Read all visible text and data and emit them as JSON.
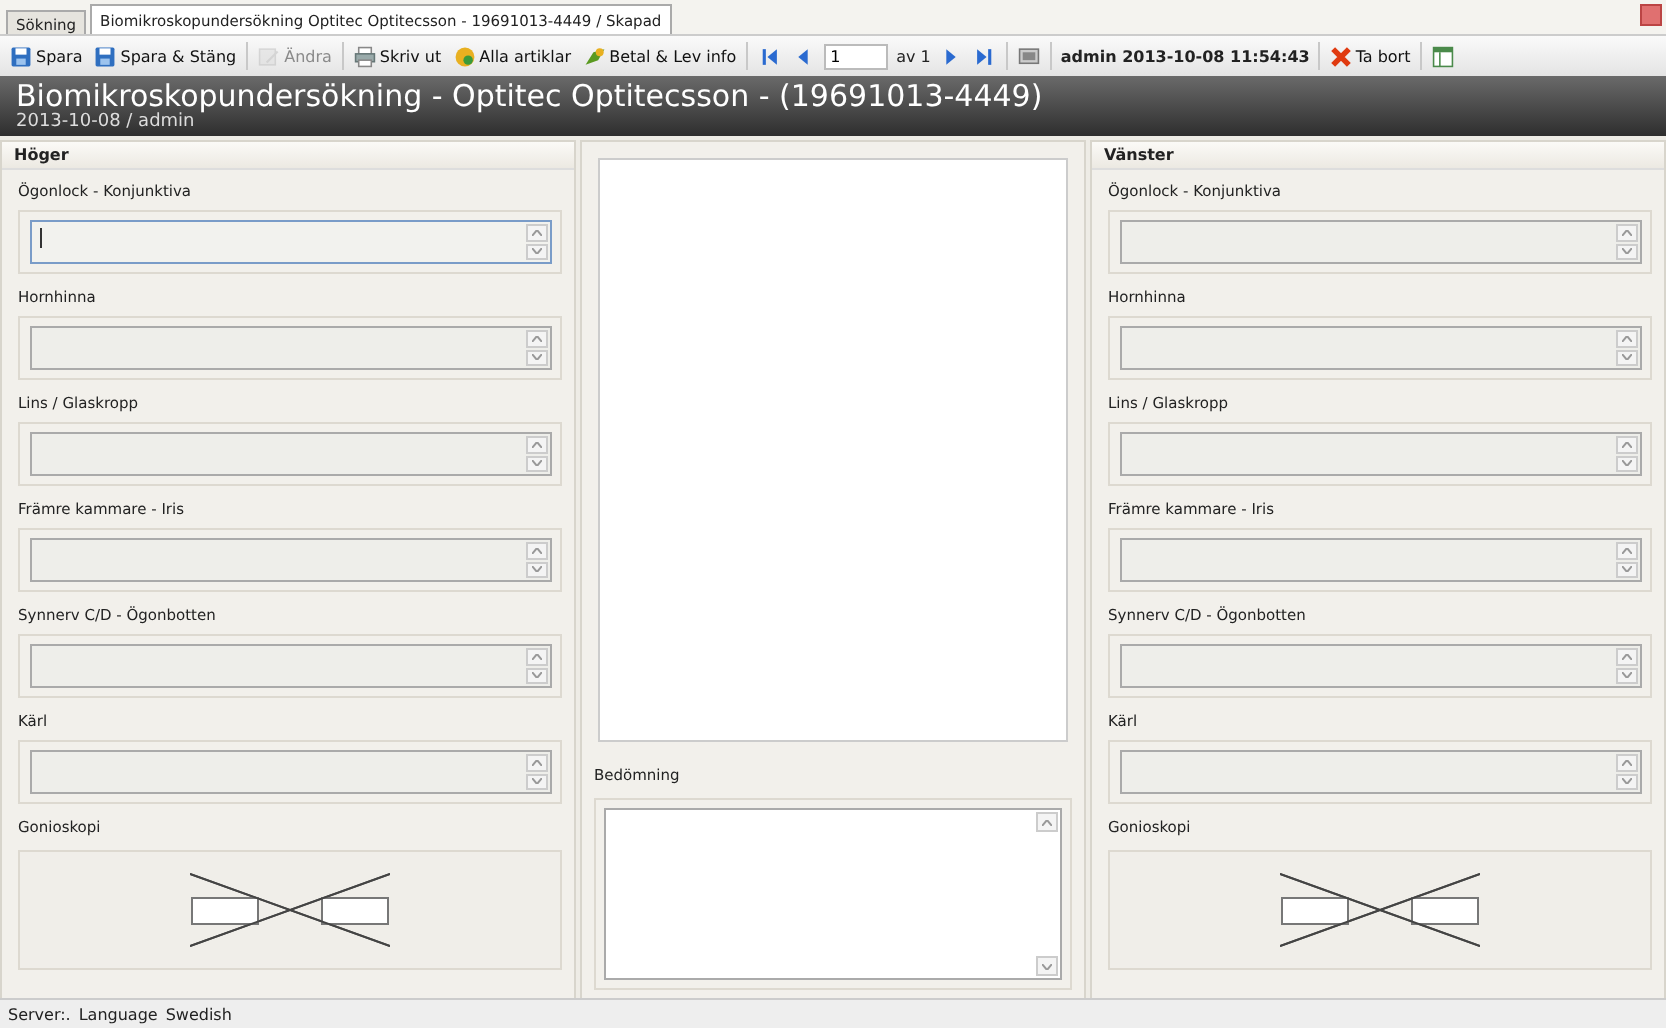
{
  "tabs": [
    {
      "label": "Sökning",
      "selected": false
    },
    {
      "label": "Biomikroskopundersökning Optitec Optitecsson - 19691013-4449 / Skapad",
      "selected": true
    }
  ],
  "toolbar": [
    {
      "kind": "save",
      "label": "Spara",
      "disabled": false
    },
    {
      "kind": "save",
      "label": "Spara & Stäng",
      "disabled": false
    },
    {
      "kind": "separator"
    },
    {
      "kind": "edit",
      "label": "Ändra",
      "disabled": true
    },
    {
      "kind": "separator"
    },
    {
      "kind": "print",
      "label": "Skriv ut",
      "disabled": false
    },
    {
      "kind": "items",
      "label": "Alla artiklar",
      "disabled": false
    },
    {
      "kind": "pay",
      "label": "Betal & Lev info",
      "disabled": false
    },
    {
      "kind": "separator"
    },
    {
      "kind": "first"
    },
    {
      "kind": "prev"
    },
    {
      "kind": "input",
      "value": "1"
    },
    {
      "kind": "text",
      "label": "av 1"
    },
    {
      "kind": "next"
    },
    {
      "kind": "last"
    },
    {
      "kind": "separator"
    },
    {
      "kind": "screen"
    },
    {
      "kind": "separator"
    },
    {
      "kind": "info",
      "label": "admin 2013-10-08 11:54:43"
    },
    {
      "kind": "separator"
    },
    {
      "kind": "delete",
      "label": "Ta bort",
      "disabled": false
    },
    {
      "kind": "separator"
    },
    {
      "kind": "layout"
    }
  ],
  "header": {
    "title": "Biomikroskopundersökning - Optitec Optitecsson - (19691013-4449)",
    "subtitle": "2013-10-08 / admin"
  },
  "panels": [
    {
      "title": "Höger",
      "fields": [
        {
          "label": "Ögonlock - Konjunktiva",
          "focused": true
        },
        {
          "label": "Hornhinna",
          "focused": false
        },
        {
          "label": "Lins / Glaskropp",
          "focused": false
        },
        {
          "label": "Främre kammare - Iris",
          "focused": false
        },
        {
          "label": "Synnerv C/D - Ögonbotten",
          "focused": false
        },
        {
          "label": "Kärl",
          "focused": false
        }
      ],
      "diagram_label": "Gonioskopi"
    },
    {
      "title": "Vänster",
      "fields": [
        {
          "label": "Ögonlock - Konjunktiva",
          "focused": false
        },
        {
          "label": "Hornhinna",
          "focused": false
        },
        {
          "label": "Lins / Glaskropp",
          "focused": false
        },
        {
          "label": "Främre kammare - Iris",
          "focused": false
        },
        {
          "label": "Synnerv C/D - Ögonbotten",
          "focused": false
        },
        {
          "label": "Kärl",
          "focused": false
        }
      ],
      "diagram_label": "Gonioskopi"
    }
  ],
  "assessment": {
    "label": "Bedömning"
  },
  "status_bar": {
    "server": "Server:.",
    "language_label": "Language",
    "language": "Swedish"
  }
}
